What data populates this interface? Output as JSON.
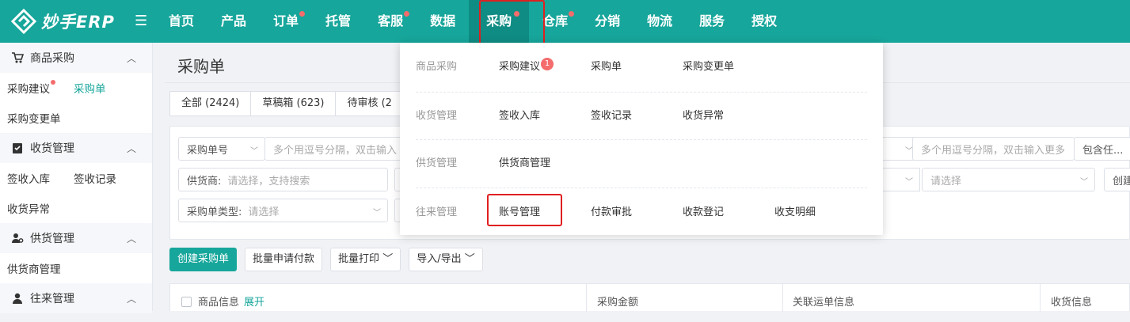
{
  "app": {
    "logo_text": "妙手ERP"
  },
  "nav": {
    "items": [
      {
        "label": "首页",
        "dot": false
      },
      {
        "label": "产品",
        "dot": false
      },
      {
        "label": "订单",
        "dot": true
      },
      {
        "label": "托管",
        "dot": false
      },
      {
        "label": "客服",
        "dot": true
      },
      {
        "label": "数据",
        "dot": false
      },
      {
        "label": "采购",
        "dot": true,
        "active": true
      },
      {
        "label": "仓库",
        "dot": true
      },
      {
        "label": "分销",
        "dot": false
      },
      {
        "label": "物流",
        "dot": false
      },
      {
        "label": "服务",
        "dot": false
      },
      {
        "label": "授权",
        "dot": false
      }
    ]
  },
  "sidebar": {
    "groups": [
      {
        "label": "商品采购",
        "icon": "cart-icon",
        "items": [
          "采购建议",
          "采购单"
        ]
      },
      {
        "extra": [
          "采购变更单"
        ]
      },
      {
        "label": "收货管理",
        "icon": "checklist-icon",
        "items": [
          "签收入库",
          "签收记录"
        ]
      },
      {
        "extra": [
          "收货异常"
        ]
      },
      {
        "label": "供货管理",
        "icon": "supplier-icon",
        "items": [
          "供货商管理"
        ]
      },
      {
        "label": "往来管理",
        "icon": "user-icon"
      }
    ]
  },
  "page": {
    "title": "采购单"
  },
  "tabs": [
    "全部 (2424)",
    "草稿箱 (623)",
    "待审核 (2"
  ],
  "filters": {
    "order_no_select": "采购单号",
    "order_no_placeholder": "多个用逗号分隔，双击输入",
    "right_placeholder": "多个用逗号分隔，双击输入更多",
    "contains_select": "包含任...",
    "supplier_label": "供货商:",
    "supplier_placeholder": "请选择，支持搜索",
    "select_placeholder": "请选择",
    "create_partial": "创建",
    "type_label": "采购单类型:",
    "type_placeholder": "请选择"
  },
  "actions": {
    "create": "创建采购单",
    "batch_pay": "批量申请付款",
    "batch_print": "批量打印",
    "import_export": "导入/导出"
  },
  "table": {
    "col_product": "商品信息",
    "expand": "展开",
    "col_amount": "采购金额",
    "col_waybill": "关联运单信息",
    "col_receive": "收货信息"
  },
  "dropdown": {
    "rows": [
      {
        "category": "商品采购",
        "links": [
          "采购建议",
          "采购单",
          "采购变更单"
        ],
        "badge": "1"
      },
      {
        "category": "收货管理",
        "links": [
          "签收入库",
          "签收记录",
          "收货异常"
        ]
      },
      {
        "category": "供货管理",
        "links": [
          "供货商管理"
        ]
      },
      {
        "category": "往来管理",
        "links": [
          "账号管理",
          "付款审批",
          "收款登记",
          "收支明细"
        ]
      }
    ]
  },
  "colors": {
    "brand": "#17a69b",
    "highlight": "#e02020",
    "badge": "#f56c6c"
  }
}
